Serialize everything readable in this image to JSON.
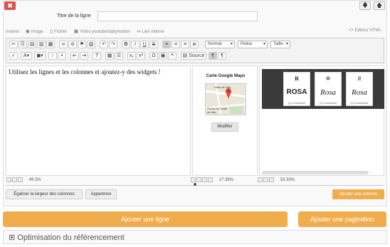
{
  "header": {
    "close_label": "✖",
    "down_label": "🡇",
    "up_label": "🡅"
  },
  "titre": {
    "label": "Titre de la ligne",
    "value": ""
  },
  "inserer": {
    "prefix": "Insérer :",
    "items": [
      {
        "label": "Image",
        "icon": "camera-icon"
      },
      {
        "label": "Fichier",
        "icon": "file-icon"
      },
      {
        "label": "Vidéo youtube/dailymotion",
        "icon": "film-icon"
      },
      {
        "label": "Lien interne",
        "icon": "link-icon"
      }
    ],
    "editeur_html": "<> Editeur HTML"
  },
  "toolbar": {
    "format": "Normal",
    "police": "Police",
    "taille": "Taille",
    "source": "Source"
  },
  "columns": {
    "col1_text": "Utilisez les lignes et les colonnes et ajoutez-y des widgets !",
    "map": {
      "title": "Carte Google Maps",
      "label1": "Hôtel de Ville",
      "label2": "Parvis de l'hôtel de ville",
      "button": "Modifier"
    },
    "cards": [
      {
        "logo": "R",
        "name": "ROSA",
        "foot": "(1) Customise"
      },
      {
        "logo": "✲",
        "name": "Rosa",
        "foot": "(1) Customise"
      },
      {
        "logo": "R",
        "name": "Rosa",
        "foot": "(1) Customise"
      }
    ],
    "widths": [
      "49.3%",
      "17.36%",
      "33.33%"
    ]
  },
  "actions": {
    "egaliser": "Égaliser la largeur des colonnes",
    "apparence": "Apparence",
    "ajouter_colonne": "Ajouter une colonne",
    "ajouter_ligne": "Ajouter une ligne",
    "ajouter_pagination": "Ajouter une pagination"
  },
  "optimisation": {
    "icon": "⊞",
    "label": "Optimisation du référencement"
  },
  "colors": {
    "orange": "#f0ad4e",
    "red": "#d9534f"
  }
}
